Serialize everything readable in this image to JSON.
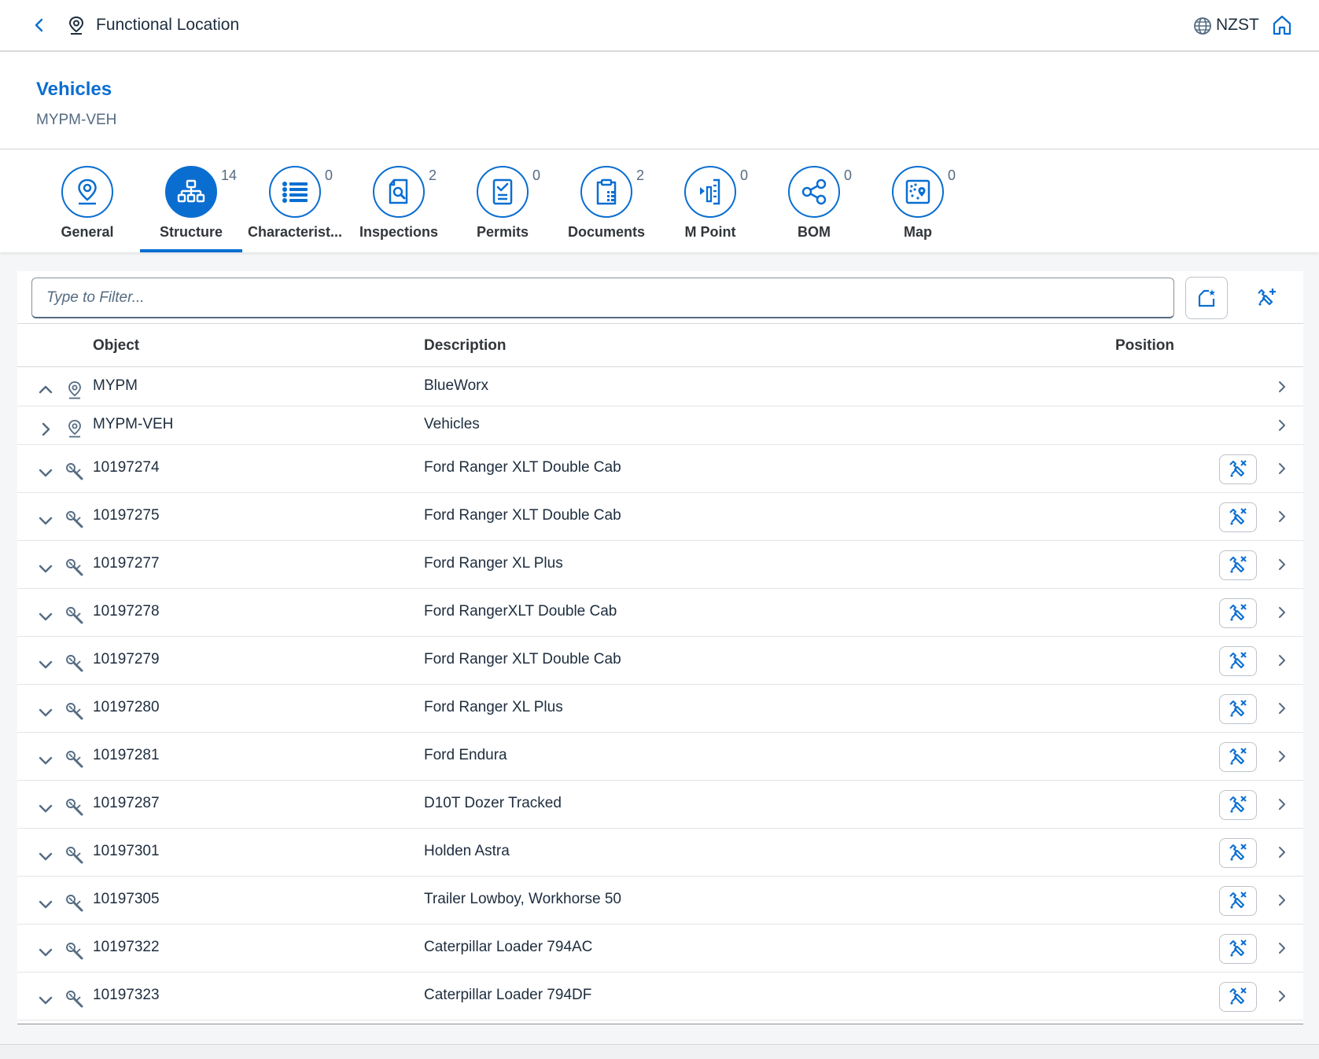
{
  "shell": {
    "back_icon": "chevron-left-icon",
    "app_icon": "location-pin-icon",
    "app_title": "Functional Location",
    "timezone_icon": "globe-icon",
    "timezone": "NZST",
    "home_icon": "home-icon"
  },
  "object_header": {
    "title": "Vehicles",
    "subtitle": "MYPM-VEH"
  },
  "tabs": [
    {
      "label": "General",
      "count": "",
      "icon": "location-pin-icon",
      "active": false
    },
    {
      "label": "Structure",
      "count": "14",
      "icon": "hierarchy-icon",
      "active": true
    },
    {
      "label": "Characterist...",
      "count": "0",
      "icon": "list-icon",
      "active": false
    },
    {
      "label": "Inspections",
      "count": "2",
      "icon": "document-search-icon",
      "active": false
    },
    {
      "label": "Permits",
      "count": "0",
      "icon": "checklist-icon",
      "active": false
    },
    {
      "label": "Documents",
      "count": "2",
      "icon": "clipboard-icon",
      "active": false
    },
    {
      "label": "M Point",
      "count": "0",
      "icon": "measuring-point-icon",
      "active": false
    },
    {
      "label": "BOM",
      "count": "0",
      "icon": "share-icon",
      "active": false
    },
    {
      "label": "Map",
      "count": "0",
      "icon": "map-icon",
      "active": false
    }
  ],
  "filter": {
    "placeholder": "Type to Filter...",
    "value": ""
  },
  "toolbar": {
    "button1_icon": "create-folder-icon",
    "button2_icon": "add-equipment-icon"
  },
  "table": {
    "columns": {
      "object": "Object",
      "description": "Description",
      "position": "Position"
    },
    "rows": [
      {
        "expand": "up",
        "type": "location",
        "object": "MYPM",
        "description": "BlueWorx",
        "position": "",
        "action": false
      },
      {
        "expand": "right",
        "type": "location",
        "object": "MYPM-VEH",
        "description": "Vehicles",
        "position": "",
        "action": false
      },
      {
        "expand": "down",
        "type": "equipment",
        "object": "10197274",
        "description": "Ford Ranger XLT Double Cab",
        "position": "",
        "action": true
      },
      {
        "expand": "down",
        "type": "equipment",
        "object": "10197275",
        "description": "Ford Ranger XLT Double Cab",
        "position": "",
        "action": true
      },
      {
        "expand": "down",
        "type": "equipment",
        "object": "10197277",
        "description": "Ford Ranger XL Plus",
        "position": "",
        "action": true
      },
      {
        "expand": "down",
        "type": "equipment",
        "object": "10197278",
        "description": "Ford RangerXLT Double Cab",
        "position": "",
        "action": true
      },
      {
        "expand": "down",
        "type": "equipment",
        "object": "10197279",
        "description": "Ford Ranger XLT Double Cab",
        "position": "",
        "action": true
      },
      {
        "expand": "down",
        "type": "equipment",
        "object": "10197280",
        "description": "Ford Ranger XL Plus",
        "position": "",
        "action": true
      },
      {
        "expand": "down",
        "type": "equipment",
        "object": "10197281",
        "description": "Ford Endura",
        "position": "",
        "action": true
      },
      {
        "expand": "down",
        "type": "equipment",
        "object": "10197287",
        "description": "D10T Dozer Tracked",
        "position": "",
        "action": true
      },
      {
        "expand": "down",
        "type": "equipment",
        "object": "10197301",
        "description": "Holden Astra",
        "position": "",
        "action": true
      },
      {
        "expand": "down",
        "type": "equipment",
        "object": "10197305",
        "description": "Trailer Lowboy, Workhorse 50",
        "position": "",
        "action": true
      },
      {
        "expand": "down",
        "type": "equipment",
        "object": "10197322",
        "description": "Caterpillar Loader 794AC",
        "position": "",
        "action": true
      },
      {
        "expand": "down",
        "type": "equipment",
        "object": "10197323",
        "description": "Caterpillar Loader 794DF",
        "position": "",
        "action": true
      }
    ]
  },
  "colors": {
    "accent": "#0a6ed1",
    "text": "#1d2d3e",
    "muted": "#556b82"
  }
}
